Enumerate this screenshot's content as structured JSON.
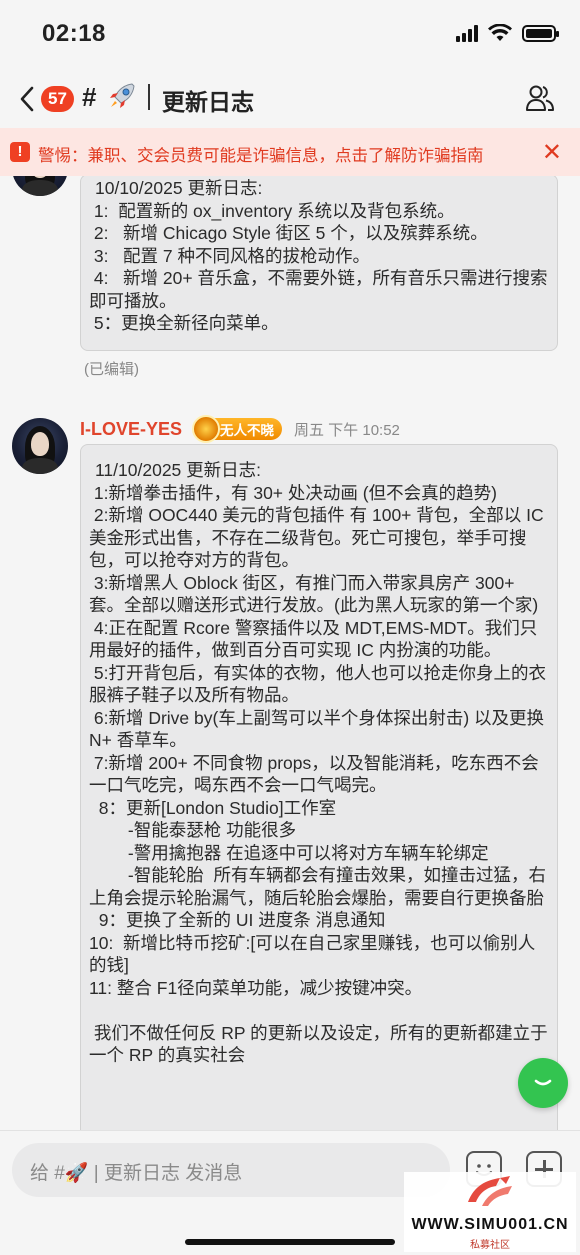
{
  "status_bar": {
    "time": "02:18"
  },
  "nav": {
    "unread_count": "57",
    "channel_prefix": "#",
    "title": "更新日志"
  },
  "warning": {
    "text": "警惕：兼职、交会员费可能是诈骗信息，点击了解防诈骗指南"
  },
  "messages": [
    {
      "lines": [
        "10/10/2025 更新日志:",
        " 1:  配置新的 ox_inventory 系统以及背包系统。",
        " 2:   新增 Chicago Style 街区 5 个，以及殡葬系统。",
        " 3:   配置 7 种不同风格的拔枪动作。",
        " 4:   新增 20+ 音乐盒，不需要外链，所有音乐只需进行搜索即可播放。",
        " 5：更换全新径向菜单。"
      ],
      "edited_label": "(已编辑)"
    },
    {
      "username": "I-LOVE-YES",
      "user_tag": "无人不晓",
      "timestamp": "周五 下午 10:52",
      "lines": [
        "11/10/2025 更新日志:",
        " 1:新增拳击插件，有 30+ 处决动画 (但不会真的趋势)",
        " 2:新增 OOC440 美元的背包插件 有 100+ 背包，全部以 IC 美金形式出售，不存在二级背包。死亡可搜包，举手可搜包，可以抢夺对方的背包。",
        " 3:新增黑人 Oblock 街区，有推门而入带家具房产 300+ 套。全部以赠送形式进行发放。(此为黑人玩家的第一个家)",
        " 4:正在配置 Rcore 警察插件以及 MDT,EMS-MDT。我们只用最好的插件，做到百分百可实现 IC 内扮演的功能。",
        " 5:打开背包后，有实体的衣物，他人也可以抢走你身上的衣服裤子鞋子以及所有物品。",
        " 6:新增 Drive by(车上副驾可以半个身体探出射击) 以及更换 N+ 香草车。",
        " 7:新增 200+ 不同食物 props，以及智能消耗，吃东西不会一口气吃完，喝东西不会一口气喝完。",
        "  8：更新[London Studio]工作室",
        "        -智能泰瑟枪 功能很多",
        "        -警用擒抱器 在追逐中可以将对方车辆车轮绑定",
        "        -智能轮胎  所有车辆都会有撞击效果，如撞击过猛，右上角会提示轮胎漏气，随后轮胎会爆胎，需要自行更换备胎",
        "  9：更换了全新的 UI 进度条 消息通知",
        "10:  新增比特币挖矿:[可以在自己家里赚钱，也可以偷别人的钱]",
        "11: 整合 F1径向菜单功能，减少按键冲突。",
        "",
        " 我们不做任何反 RP 的更新以及设定，所有的更新都建立于一个 RP 的真实社会"
      ]
    }
  ],
  "input": {
    "placeholder": "给 #🚀 | 更新日志 发消息"
  },
  "watermark": {
    "site": "WWW.SIMU001.CN",
    "sub": "私募社区"
  },
  "colors": {
    "accent_red": "#ef4023",
    "warning_bg": "#fde6e2",
    "username": "#e0452c",
    "float_button": "#33c450"
  },
  "icons": [
    "back-icon",
    "rocket-icon",
    "members-icon",
    "warning-icon",
    "close-icon",
    "chevron-down-icon",
    "emoji-icon",
    "plus-icon"
  ]
}
